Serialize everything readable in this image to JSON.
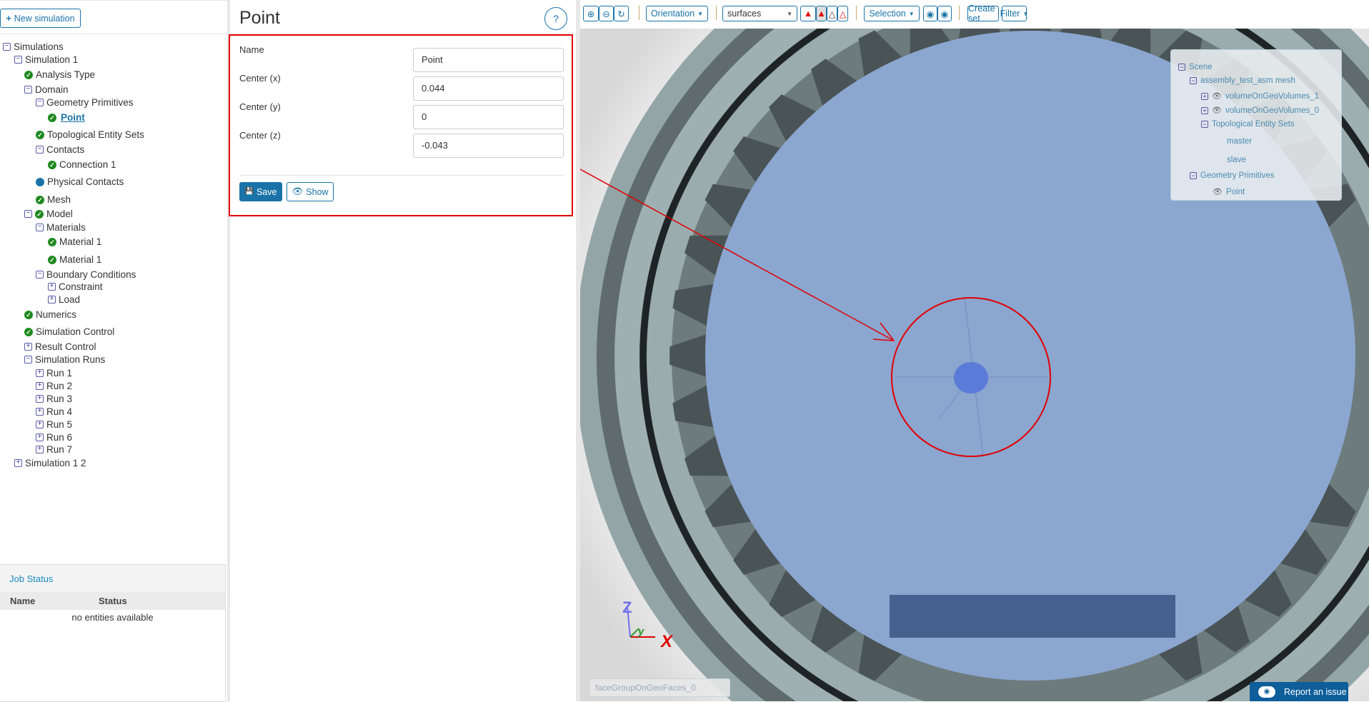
{
  "left": {
    "new_simulation": "New simulation",
    "tree": [
      {
        "label": "Simulations",
        "level": 0,
        "icon": "minus"
      },
      {
        "label": "Simulation 1",
        "level": 1,
        "icon": "minus"
      },
      {
        "label": "Analysis Type",
        "level": 2,
        "icon": "check"
      },
      {
        "label": "Domain",
        "level": 2,
        "icon": "minus"
      },
      {
        "label": "Geometry Primitives",
        "level": 3,
        "icon": "minus"
      },
      {
        "label": "Point",
        "level": 4,
        "icon": "check",
        "selected": true
      },
      {
        "label": "Topological Entity Sets",
        "level": 3,
        "icon": "check"
      },
      {
        "label": "Contacts",
        "level": 3,
        "icon": "minus"
      },
      {
        "label": "Connection 1",
        "level": 4,
        "icon": "check"
      },
      {
        "label": "Physical Contacts",
        "level": 3,
        "icon": "dot"
      },
      {
        "label": "Mesh",
        "level": 3,
        "icon": "check"
      },
      {
        "label": "Model",
        "level": 2,
        "icon": "minus-check"
      },
      {
        "label": "Materials",
        "level": 3,
        "icon": "minus"
      },
      {
        "label": "Material 1",
        "level": 4,
        "icon": "check"
      },
      {
        "label": "Material 1",
        "level": 4,
        "icon": "check"
      },
      {
        "label": "Boundary Conditions",
        "level": 3,
        "icon": "minus"
      },
      {
        "label": "Constraint",
        "level": 4,
        "icon": "plus"
      },
      {
        "label": "Load",
        "level": 4,
        "icon": "plus"
      },
      {
        "label": "Numerics",
        "level": 2,
        "icon": "check"
      },
      {
        "label": "Simulation Control",
        "level": 2,
        "icon": "check"
      },
      {
        "label": "Result Control",
        "level": 2,
        "icon": "plus"
      },
      {
        "label": "Simulation Runs",
        "level": 2,
        "icon": "minus"
      },
      {
        "label": "Run 1",
        "level": 3,
        "icon": "plus"
      },
      {
        "label": "Run 2",
        "level": 3,
        "icon": "plus"
      },
      {
        "label": "Run 3",
        "level": 3,
        "icon": "plus"
      },
      {
        "label": "Run 4",
        "level": 3,
        "icon": "plus"
      },
      {
        "label": "Run 5",
        "level": 3,
        "icon": "plus"
      },
      {
        "label": "Run 6",
        "level": 3,
        "icon": "plus"
      },
      {
        "label": "Run 7",
        "level": 3,
        "icon": "plus"
      },
      {
        "label": "Simulation 1 2",
        "level": 1,
        "icon": "plus"
      }
    ],
    "job_status": {
      "title": "Job Status",
      "col_name": "Name",
      "col_status": "Status",
      "empty": "no entities available"
    }
  },
  "form": {
    "title": "Point",
    "help": "?",
    "fields": [
      {
        "label": "Name",
        "value": "Point"
      },
      {
        "label": "Center (x)",
        "value": "0.044"
      },
      {
        "label": "Center (y)",
        "value": "0"
      },
      {
        "label": "Center (z)",
        "value": "-0.043"
      }
    ],
    "save": "Save",
    "show": "Show"
  },
  "toolbar": {
    "orientation": "Orientation",
    "render_mode": "surfaces",
    "selection": "Selection",
    "create_set": "Create set",
    "filter": "Filter"
  },
  "scene": {
    "items": [
      {
        "label": "Scene",
        "indent": 0,
        "toggle": "minus"
      },
      {
        "label": "assembly_test_asm mesh",
        "indent": 1,
        "toggle": "minus"
      },
      {
        "label": "volumeOnGeoVolumes_1",
        "indent": 2,
        "toggle": "plus",
        "eye": true
      },
      {
        "label": "volumeOnGeoVolumes_0",
        "indent": 2,
        "toggle": "plus",
        "eye": true
      },
      {
        "label": "Topological Entity Sets",
        "indent": 2,
        "toggle": "minus"
      },
      {
        "label": "master",
        "indent": 4
      },
      {
        "label": "slave",
        "indent": 4
      },
      {
        "label": "Geometry Primitives",
        "indent": 1,
        "toggle": "minus"
      },
      {
        "label": "Point",
        "indent": 3,
        "eye": true
      }
    ]
  },
  "viewer": {
    "hover_label": "faceGroupOnGeoFaces_0",
    "axis": {
      "x": "X",
      "y": "y",
      "z": "Z"
    },
    "report": "Report an issue"
  },
  "colors": {
    "accent": "#1a73a8",
    "check": "#1e8a1e",
    "highlight": "#e00000",
    "report_bg": "#0d5e9a"
  }
}
